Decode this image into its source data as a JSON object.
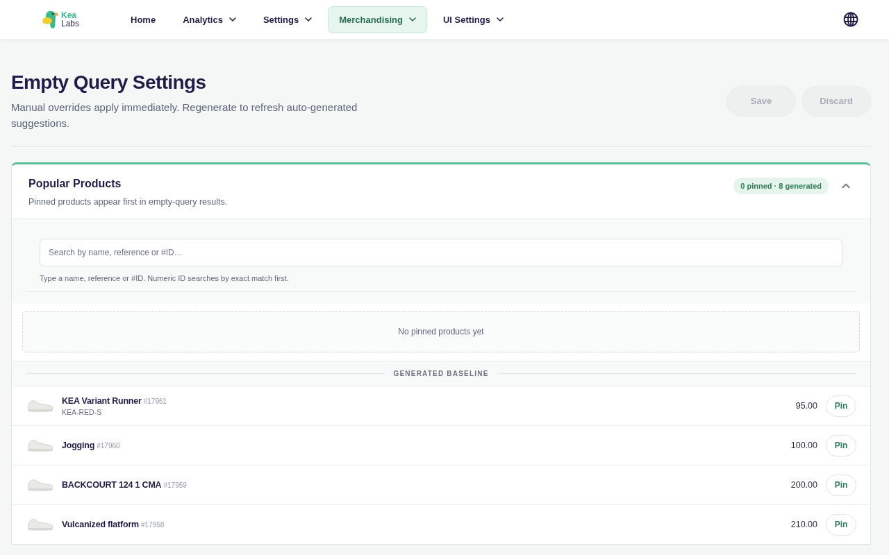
{
  "header": {
    "logo": {
      "line_1": "Kea",
      "line_2": "Labs"
    },
    "nav": [
      {
        "label": "Home",
        "kind": "link",
        "selected": false
      },
      {
        "label": "Analytics",
        "kind": "dropdown",
        "selected": false
      },
      {
        "label": "Settings",
        "kind": "dropdown",
        "selected": false
      },
      {
        "label": "Merchandising",
        "kind": "dropdown",
        "selected": true
      },
      {
        "label": "UI Settings",
        "kind": "dropdown",
        "selected": false
      }
    ]
  },
  "page": {
    "title": "Empty Query Settings",
    "subtitle": "Manual overrides apply immediately. Regenerate to refresh auto-generated suggestions.",
    "actions": [
      {
        "label": "Save",
        "disabled": true
      },
      {
        "label": "Discard",
        "disabled": true
      }
    ]
  },
  "panel": {
    "title": "Popular Products",
    "subtitle": "Pinned products appear first in empty-query results.",
    "badge": "0 pinned · 8 generated",
    "expanded": true,
    "search": {
      "placeholder": "Search by name, reference or #ID…",
      "hint": "Type a name, reference or #ID. Numeric ID searches by exact match first."
    },
    "pinned_empty": "No pinned products yet",
    "baseline_heading": "GENERATED BASELINE",
    "products": [
      {
        "name": "KEA Variant Runner",
        "id": "#17961",
        "reference": "KEA-RED-S",
        "price": "95.00",
        "action": "Pin"
      },
      {
        "name": "Jogging",
        "id": "#17960",
        "price": "100.00",
        "action": "Pin"
      },
      {
        "name": "BACKCOURT 124 1 CMA",
        "id": "#17959",
        "price": "200.00",
        "action": "Pin"
      },
      {
        "name": "Vulcanized flatform",
        "id": "#17958",
        "price": "210.00",
        "action": "Pin"
      }
    ]
  }
}
